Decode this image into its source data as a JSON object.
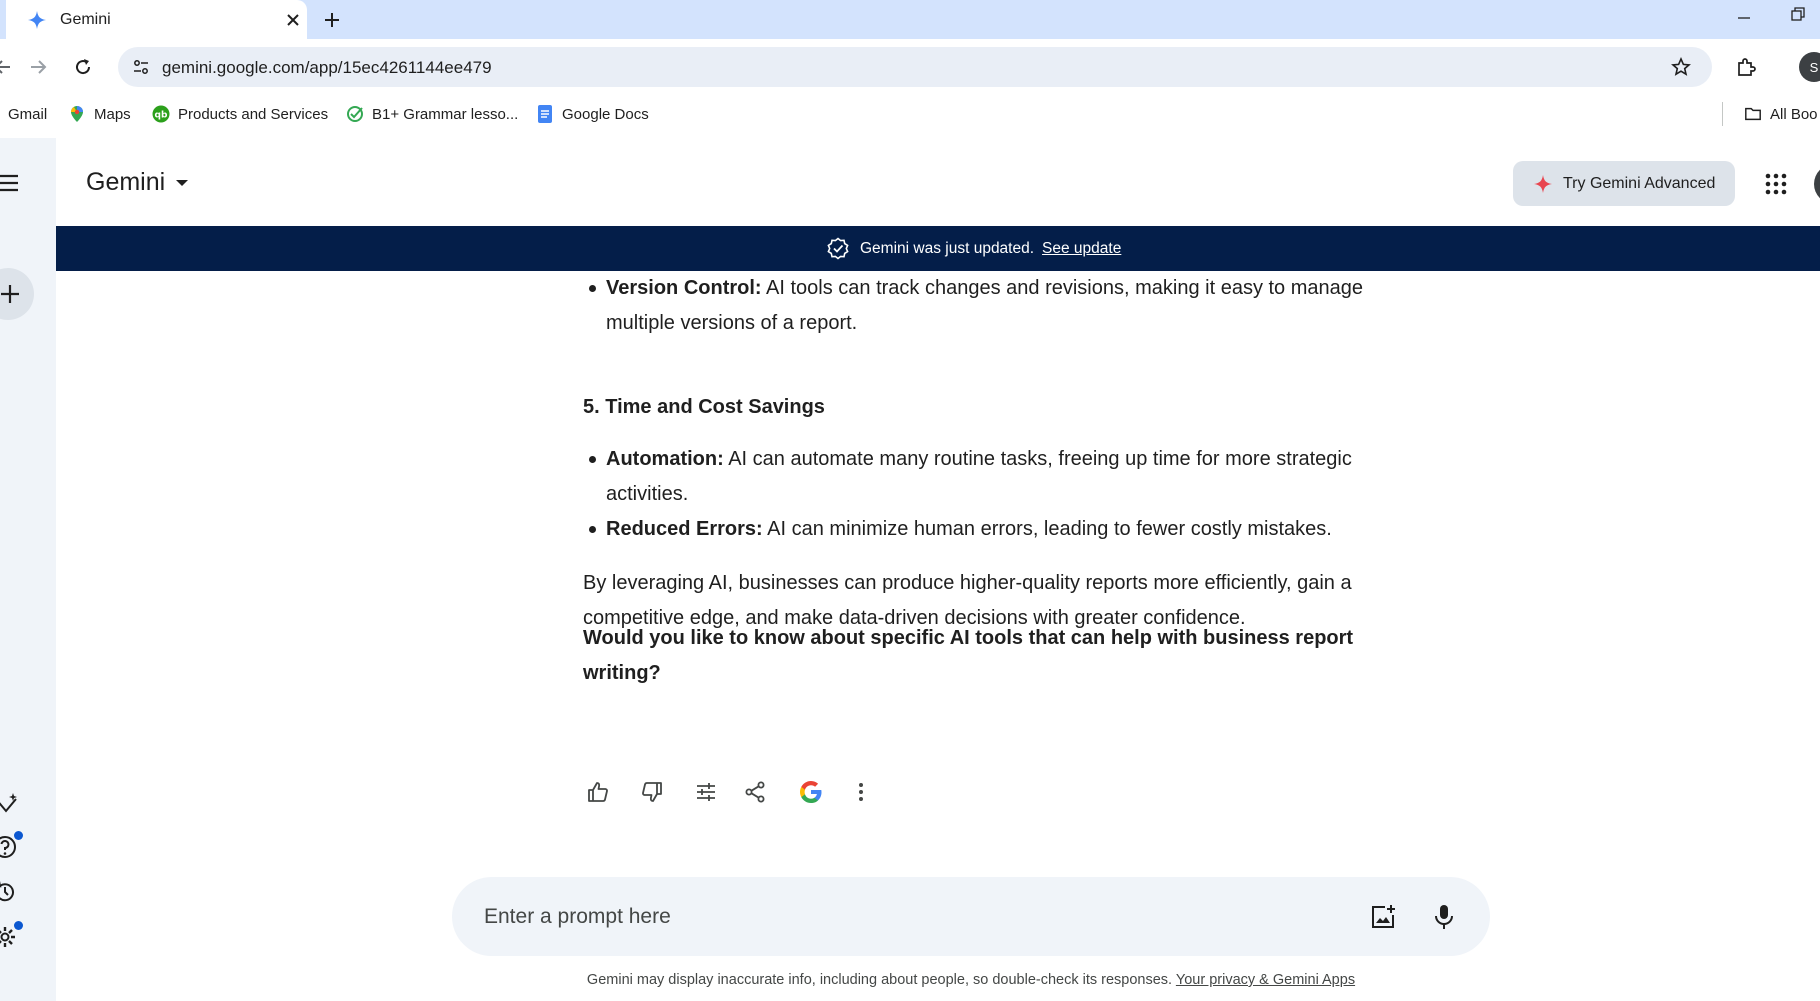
{
  "browser": {
    "tab_title": "Gemini",
    "url": "gemini.google.com/app/15ec4261144ee479",
    "profile_initial": "S",
    "bookmarks": [
      {
        "label": "Gmail",
        "icon": "gmail-icon"
      },
      {
        "label": "Maps",
        "icon": "maps-pin-icon"
      },
      {
        "label": "Products and Services",
        "icon": "quickbooks-icon"
      },
      {
        "label": "B1+ Grammar lesso...",
        "icon": "check-circle-icon"
      },
      {
        "label": "Google Docs",
        "icon": "docs-icon"
      },
      {
        "label": "All Boo",
        "icon": "folder-icon"
      }
    ]
  },
  "header": {
    "app_name": "Gemini",
    "try_advanced_label": "Try Gemini Advanced"
  },
  "banner": {
    "text": "Gemini was just updated.",
    "link_label": "See update"
  },
  "response": {
    "top_bullets": [
      {
        "term": "Version Control:",
        "text": " AI tools can track changes and revisions, making it easy to manage multiple versions of a report."
      }
    ],
    "section_heading": "5. Time and Cost Savings",
    "section_bullets": [
      {
        "term": "Automation:",
        "text": " AI can automate many routine tasks, freeing up time for more strategic activities."
      },
      {
        "term": "Reduced Errors:",
        "text": " AI can minimize human errors, leading to fewer costly mistakes."
      }
    ],
    "paragraph": "By leveraging AI, businesses can produce higher-quality reports more efficiently, gain a competitive edge, and make data-driven decisions with greater confidence.",
    "follow_up_question": "Would you like to know about specific AI tools that can help with business report writing?"
  },
  "prompt": {
    "placeholder": "Enter a prompt here"
  },
  "footer": {
    "disclaimer": "Gemini may display inaccurate info, including about people, so double-check its responses.",
    "privacy_link": "Your privacy & Gemini Apps"
  },
  "colors": {
    "banner_bg": "#041e49",
    "accent_blue": "#0b57d0",
    "surface": "#f0f4f9",
    "tab_strip": "#d3e3fd"
  }
}
